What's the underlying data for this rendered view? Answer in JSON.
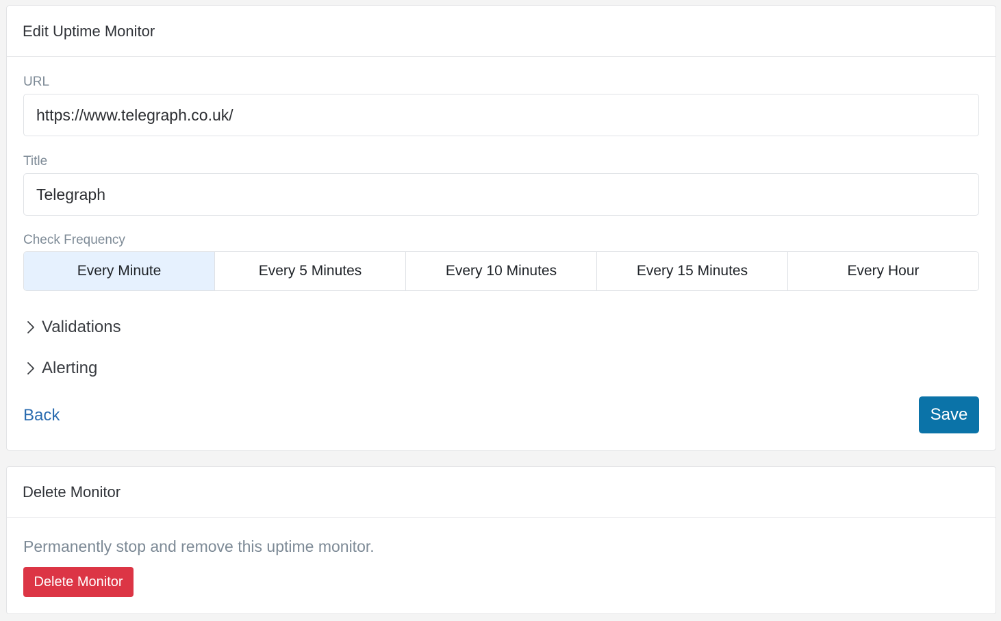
{
  "edit_card": {
    "title": "Edit Uptime Monitor",
    "url_label": "URL",
    "url_value": "https://www.telegraph.co.uk/",
    "title_label": "Title",
    "title_value": "Telegraph",
    "frequency_label": "Check Frequency",
    "frequency_options": [
      {
        "label": "Every Minute",
        "selected": true
      },
      {
        "label": "Every 5 Minutes",
        "selected": false
      },
      {
        "label": "Every 10 Minutes",
        "selected": false
      },
      {
        "label": "Every 15 Minutes",
        "selected": false
      },
      {
        "label": "Every Hour",
        "selected": false
      }
    ],
    "sections": [
      {
        "label": "Validations",
        "icon": "chevron-right-icon"
      },
      {
        "label": "Alerting",
        "icon": "chevron-right-icon"
      }
    ],
    "back_label": "Back",
    "save_label": "Save"
  },
  "delete_card": {
    "title": "Delete Monitor",
    "description": "Permanently stop and remove this uptime monitor.",
    "button_label": "Delete Monitor"
  },
  "colors": {
    "page_background": "#f4f4f4",
    "selected_option": "#e6f1fe",
    "link": "#2b6cb0",
    "primary_button": "#0b73a8",
    "danger_button": "#dc3545",
    "label_text": "#7d8a96"
  }
}
